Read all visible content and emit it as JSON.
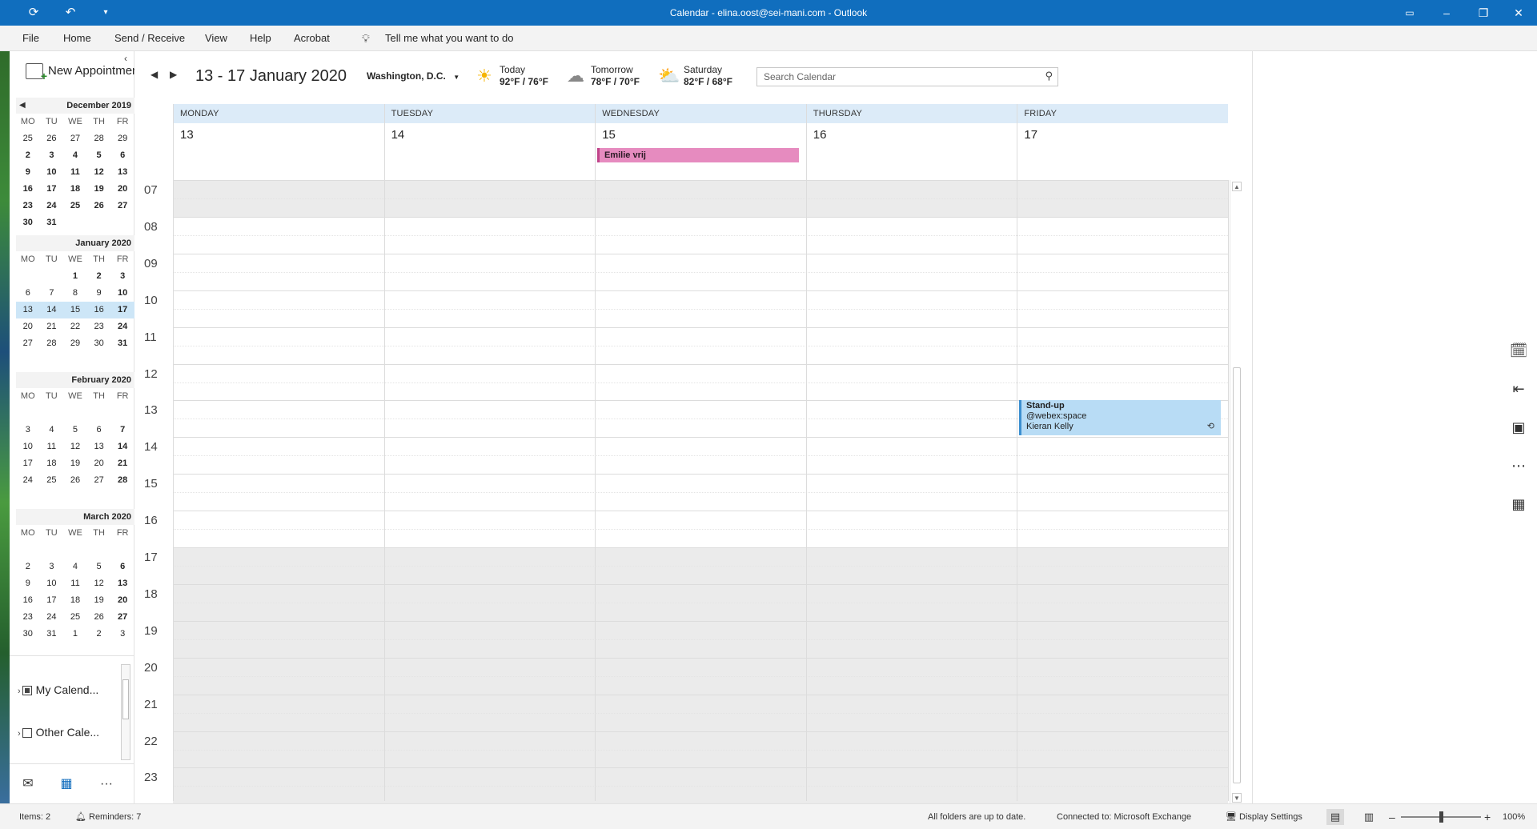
{
  "titlebar": {
    "title": "Calendar - elina.oost@sei-mani.com  -  Outlook",
    "sync_icon": "sync-icon",
    "undo_icon": "undo-icon",
    "customize_icon": "customize-toolbar-icon"
  },
  "menu": {
    "items": [
      "File",
      "Home",
      "Send / Receive",
      "View",
      "Help",
      "Acrobat"
    ],
    "tell_me": "Tell me what you want to do"
  },
  "sidebar": {
    "new_appointment": "New Appointment",
    "months": [
      {
        "title": "December 2019",
        "dow": [
          "MO",
          "TU",
          "WE",
          "TH",
          "FR"
        ],
        "weeks": [
          [
            "25",
            "26",
            "27",
            "28",
            "29"
          ],
          [
            "2",
            "3",
            "4",
            "5",
            "6"
          ],
          [
            "9",
            "10",
            "11",
            "12",
            "13"
          ],
          [
            "16",
            "17",
            "18",
            "19",
            "20"
          ],
          [
            "23",
            "24",
            "25",
            "26",
            "27"
          ],
          [
            "30",
            "31",
            "",
            "",
            ""
          ]
        ]
      },
      {
        "title": "January 2020",
        "dow": [
          "MO",
          "TU",
          "WE",
          "TH",
          "FR"
        ],
        "weeks": [
          [
            "",
            "",
            "1",
            "2",
            "3"
          ],
          [
            "6",
            "7",
            "8",
            "9",
            "10"
          ],
          [
            "13",
            "14",
            "15",
            "16",
            "17"
          ],
          [
            "20",
            "21",
            "22",
            "23",
            "24"
          ],
          [
            "27",
            "28",
            "29",
            "30",
            "31"
          ]
        ]
      },
      {
        "title": "February 2020",
        "dow": [
          "MO",
          "TU",
          "WE",
          "TH",
          "FR"
        ],
        "weeks": [
          [
            "",
            "",
            "",
            "",
            ""
          ],
          [
            "3",
            "4",
            "5",
            "6",
            "7"
          ],
          [
            "10",
            "11",
            "12",
            "13",
            "14"
          ],
          [
            "17",
            "18",
            "19",
            "20",
            "21"
          ],
          [
            "24",
            "25",
            "26",
            "27",
            "28"
          ]
        ]
      },
      {
        "title": "March 2020",
        "dow": [
          "MO",
          "TU",
          "WE",
          "TH",
          "FR"
        ],
        "weeks": [
          [
            "",
            "",
            "",
            "",
            ""
          ],
          [
            "2",
            "3",
            "4",
            "5",
            "6"
          ],
          [
            "9",
            "10",
            "11",
            "12",
            "13"
          ],
          [
            "16",
            "17",
            "18",
            "19",
            "20"
          ],
          [
            "23",
            "24",
            "25",
            "26",
            "27"
          ],
          [
            "30",
            "31",
            "1",
            "2",
            "3"
          ]
        ]
      }
    ],
    "folders": [
      {
        "label": "My Calend...",
        "checked": true
      },
      {
        "label": "Other Cale...",
        "checked": false
      }
    ]
  },
  "calendar": {
    "date_range": "13 - 17 January 2020",
    "location": "Washington, D.C.",
    "weather": [
      {
        "label": "Today",
        "temp": "92°F / 76°F",
        "icon": "sun-icon"
      },
      {
        "label": "Tomorrow",
        "temp": "78°F / 70°F",
        "icon": "cloud-icon"
      },
      {
        "label": "Saturday",
        "temp": "82°F / 68°F",
        "icon": "partly-sunny-icon"
      }
    ],
    "search_placeholder": "Search Calendar",
    "days": [
      {
        "name": "MONDAY",
        "num": "13"
      },
      {
        "name": "TUESDAY",
        "num": "14"
      },
      {
        "name": "WEDNESDAY",
        "num": "15"
      },
      {
        "name": "THURSDAY",
        "num": "16"
      },
      {
        "name": "FRIDAY",
        "num": "17"
      }
    ],
    "hours": [
      "07",
      "08",
      "09",
      "10",
      "11",
      "12",
      "13",
      "14",
      "15",
      "16",
      "17",
      "18",
      "19",
      "20",
      "21",
      "22",
      "23"
    ],
    "events": {
      "all_day": {
        "title": "Emilie vrij",
        "color": "#e68bbf"
      },
      "standup": {
        "title": "Stand-up",
        "location": "@webex:space",
        "organizer": "Kieran Kelly",
        "color": "#b8dcf5"
      }
    }
  },
  "statusbar": {
    "items": "Items: 2",
    "reminders": "Reminders: 7",
    "sync_status": "All folders are up to date.",
    "connection": "Connected to: Microsoft Exchange",
    "display_settings": "Display Settings",
    "zoom": "100%"
  },
  "colors": {
    "accent": "#106ebe",
    "header_band": "#dcebf8",
    "off_hours": "#ebebeb"
  }
}
